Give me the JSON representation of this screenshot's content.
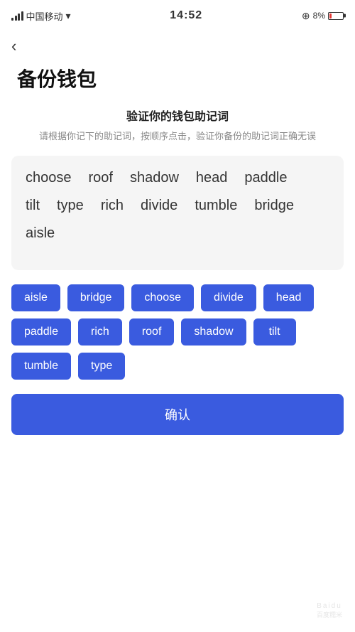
{
  "statusBar": {
    "carrier": "中国移动",
    "time": "14:52",
    "battery_pct": "8%",
    "wifi": "WiFi"
  },
  "backBtn": "‹",
  "pageTitle": "备份钱包",
  "sectionHeading": "验证你的钱包助记词",
  "sectionDesc": "请根据你记下的助记词，按顺序点击，验证你备份的助记词正确无误",
  "displayWords": [
    "choose",
    "roof",
    "shadow",
    "head",
    "paddle",
    "tilt",
    "type",
    "rich",
    "divide",
    "tumble",
    "bridge",
    "aisle"
  ],
  "chips": [
    {
      "label": "aisle"
    },
    {
      "label": "bridge"
    },
    {
      "label": "choose"
    },
    {
      "label": "divide"
    },
    {
      "label": "head"
    },
    {
      "label": "paddle"
    },
    {
      "label": "rich"
    },
    {
      "label": "roof"
    },
    {
      "label": "shadow"
    },
    {
      "label": "tilt"
    },
    {
      "label": "tumble"
    },
    {
      "label": "type"
    }
  ],
  "confirmBtn": "确认"
}
